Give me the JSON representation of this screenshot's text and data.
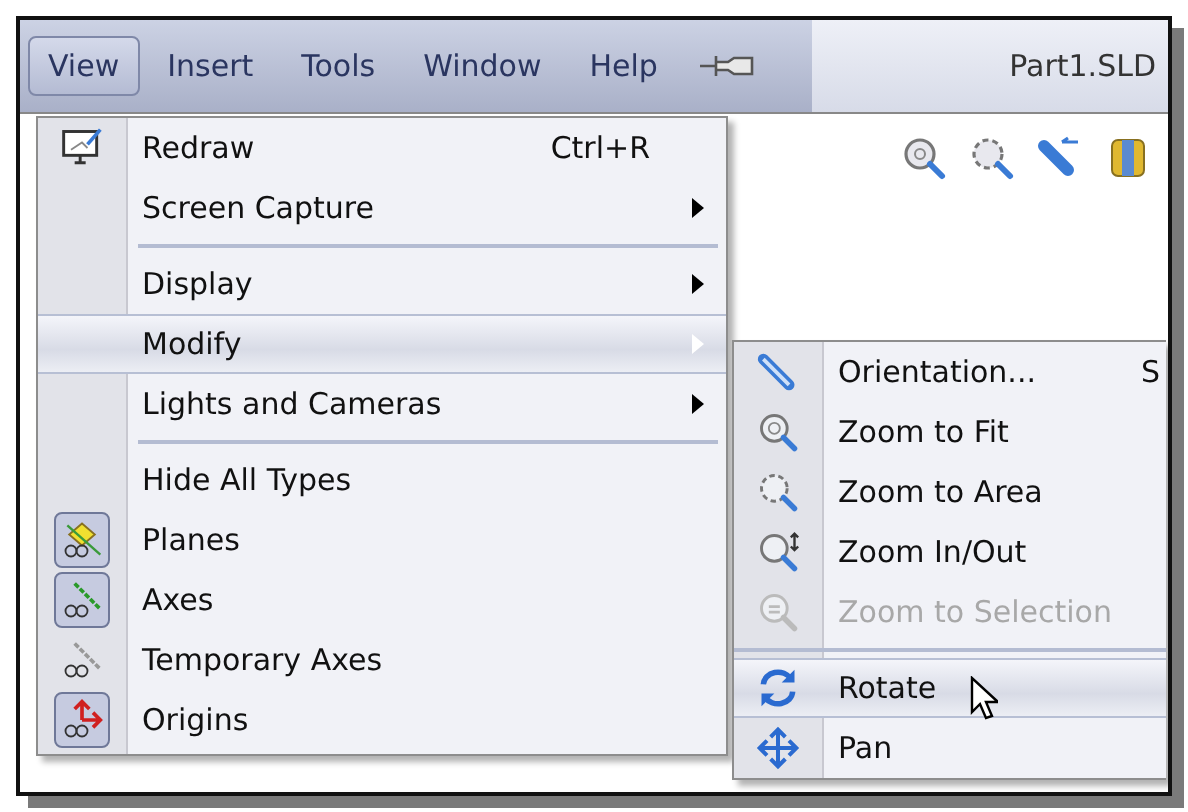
{
  "menubar": {
    "items": [
      {
        "label": "View",
        "selected": true
      },
      {
        "label": "Insert",
        "selected": false
      },
      {
        "label": "Tools",
        "selected": false
      },
      {
        "label": "Window",
        "selected": false
      },
      {
        "label": "Help",
        "selected": false
      }
    ]
  },
  "document_title": "Part1.SLD",
  "view_menu": {
    "items": [
      {
        "kind": "item",
        "label": "Redraw",
        "shortcut": "Ctrl+R",
        "submenu": false,
        "selected": false
      },
      {
        "kind": "item",
        "label": "Screen Capture",
        "submenu": true,
        "selected": false
      },
      {
        "kind": "separator"
      },
      {
        "kind": "item",
        "label": "Display",
        "submenu": true,
        "selected": false
      },
      {
        "kind": "item",
        "label": "Modify",
        "submenu": true,
        "selected": true
      },
      {
        "kind": "item",
        "label": "Lights and Cameras",
        "submenu": true,
        "selected": false
      },
      {
        "kind": "separator"
      },
      {
        "kind": "item",
        "label": "Hide All Types",
        "submenu": false,
        "selected": false
      },
      {
        "kind": "item",
        "label": "Planes",
        "submenu": false,
        "selected": false,
        "checked": true
      },
      {
        "kind": "item",
        "label": "Axes",
        "submenu": false,
        "selected": false,
        "checked": true
      },
      {
        "kind": "item",
        "label": "Temporary Axes",
        "submenu": false,
        "selected": false,
        "checked": false
      },
      {
        "kind": "item",
        "label": "Origins",
        "submenu": false,
        "selected": false,
        "checked": true
      }
    ]
  },
  "modify_submenu": {
    "items": [
      {
        "kind": "item",
        "label": "Orientation...",
        "shortcut": "S",
        "selected": false,
        "disabled": false
      },
      {
        "kind": "item",
        "label": "Zoom to Fit",
        "selected": false,
        "disabled": false
      },
      {
        "kind": "item",
        "label": "Zoom to Area",
        "selected": false,
        "disabled": false
      },
      {
        "kind": "item",
        "label": "Zoom In/Out",
        "selected": false,
        "disabled": false
      },
      {
        "kind": "item",
        "label": "Zoom to Selection",
        "selected": false,
        "disabled": true
      },
      {
        "kind": "separator"
      },
      {
        "kind": "item",
        "label": "Rotate",
        "selected": true,
        "disabled": false
      },
      {
        "kind": "item",
        "label": "Pan",
        "selected": false,
        "disabled": false
      }
    ]
  }
}
